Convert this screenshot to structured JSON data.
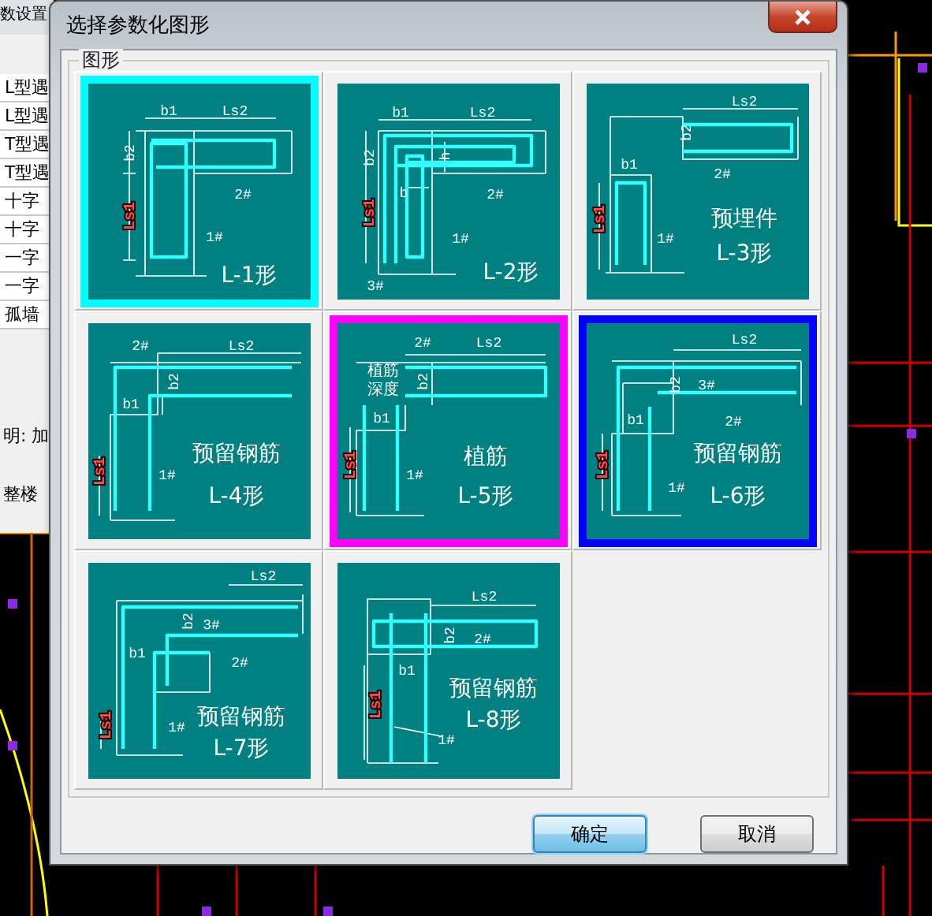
{
  "background_app": {
    "title": "数设置",
    "list_items": [
      "L型遇",
      "L型遇",
      "T型遇",
      "T型遇",
      "十字",
      "十字",
      "一字",
      "一字",
      "孤墙"
    ],
    "notes": [
      "明: 加",
      "整楼"
    ]
  },
  "window": {
    "title": "选择参数化图形"
  },
  "group": {
    "label": "图形"
  },
  "shapes": [
    {
      "color": "#00ffff",
      "labels": [
        "b1",
        "Ls2",
        "b2",
        "Ls1",
        "2#",
        "1#"
      ],
      "caption": [
        "L-1形"
      ]
    },
    {
      "labels": [
        "b1",
        "Ls2",
        "b2",
        "h",
        "Ls1",
        "b",
        "2#",
        "1#",
        "3#"
      ],
      "caption": [
        "L-2形"
      ]
    },
    {
      "labels": [
        "Ls2",
        "b2",
        "b1",
        "2#",
        "Ls1",
        "1#"
      ],
      "caption": [
        "预埋件",
        "L-3形"
      ]
    },
    {
      "labels": [
        "2#",
        "Ls2",
        "b2",
        "b1",
        "Ls1",
        "1#"
      ],
      "caption": [
        "预留钢筋",
        "L-4形"
      ]
    },
    {
      "color": "#ff00ff",
      "labels": [
        "2#",
        "Ls2",
        "植筋",
        "深度",
        "b2",
        "b1",
        "Ls1",
        "1#"
      ],
      "caption": [
        "植筋",
        "L-5形"
      ]
    },
    {
      "color": "#0000ff",
      "labels": [
        "Ls2",
        "b2",
        "3#",
        "b1",
        "2#",
        "Ls1",
        "1#"
      ],
      "caption": [
        "预留钢筋",
        "L-6形"
      ]
    },
    {
      "labels": [
        "Ls2",
        "b2",
        "3#",
        "b1",
        "2#",
        "Ls1",
        "1#"
      ],
      "caption": [
        "预留钢筋",
        "L-7形"
      ]
    },
    {
      "labels": [
        "Ls2",
        "b2",
        "2#",
        "b1",
        "Ls1",
        "1#"
      ],
      "caption": [
        "预留钢筋",
        "L-8形"
      ]
    }
  ],
  "buttons": [
    {
      "label": "确定",
      "default": true
    },
    {
      "label": "取消",
      "default": false
    }
  ]
}
